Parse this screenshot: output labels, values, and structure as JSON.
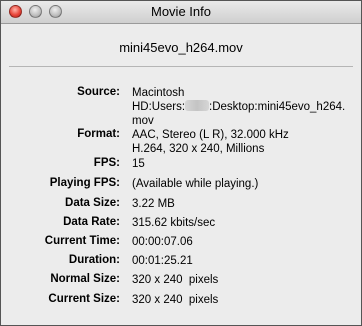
{
  "window": {
    "title": "Movie Info"
  },
  "movie": {
    "filename": "mini45evo_h264.mov"
  },
  "info": {
    "source_label": "Source:",
    "source_line1": "Macintosh",
    "source_line2a": "HD:Users:",
    "source_line2b": ":Desktop:mini45evo_h264.",
    "source_line3": "mov",
    "format_label": "Format:",
    "format_line1": "AAC, Stereo (L R), 32.000 kHz",
    "format_line2": "H.264, 320 x 240, Millions",
    "fps_label": "FPS:",
    "fps_value": "15",
    "playing_fps_label": "Playing FPS:",
    "playing_fps_value": "(Available while playing.)",
    "data_size_label": "Data Size:",
    "data_size_value": "3.22 MB",
    "data_rate_label": "Data Rate:",
    "data_rate_value": "315.62 kbits/sec",
    "current_time_label": "Current Time:",
    "current_time_value": "00:00:07.06",
    "duration_label": "Duration:",
    "duration_value": "00:01:25.21",
    "normal_size_label": "Normal Size:",
    "normal_size_value": "320 x 240  pixels",
    "current_size_label": "Current Size:",
    "current_size_value": "320 x 240  pixels"
  }
}
